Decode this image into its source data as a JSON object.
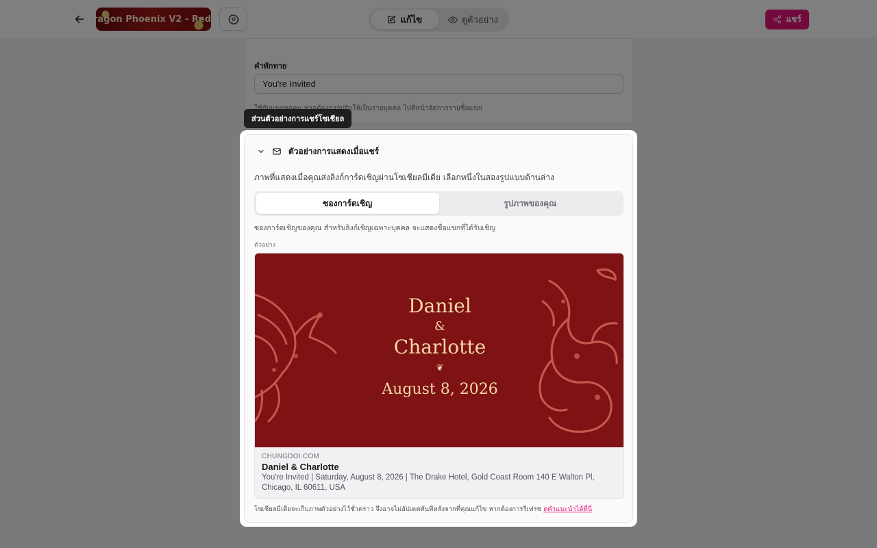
{
  "topbar": {
    "theme_name": "ragon Phoenix V2 - Red",
    "mode_edit": "แก้ไข",
    "mode_preview": "ดูตัวอย่าง",
    "share_label": "แชร์"
  },
  "greeting": {
    "label": "คำทักทาย",
    "value": "You're Invited",
    "hint": "ใช้กับแขกทุกคน หากต้องการปรับให้เป็นรายบุคคล ไปที่หน้าจัดการรายชื่อแขก"
  },
  "tooltip": "ส่วนตัวอย่างการแชร์โซเชียล",
  "share_preview": {
    "title": "ตัวอย่างการแสดงเมื่อแชร์",
    "description": "ภาพที่แสดงเมื่อคุณส่งลิงก์การ์ดเชิญผ่านโซเชียลมีเดีย เลือกหนึ่งในสองรูปแบบด้านล่าง",
    "tabs": [
      "ซองการ์ดเชิญ",
      "รูปภาพของคุณ"
    ],
    "selected_tab": "ซองการ์ดเชิญ",
    "tab_description": "ซองการ์ดเชิญของคุณ สำหรับลิงก์เชิญเฉพาะบุคคล จะแสดงชื่อแขกที่ได้รับเชิญ",
    "example_label": "ตัวอย่าง",
    "invite": {
      "name1": "Daniel",
      "amp": "&",
      "name2": "Charlotte",
      "ornament": "❦",
      "date": "August 8, 2026"
    },
    "meta": {
      "domain": "CHUNGDOI.COM",
      "title": "Daniel & Charlotte",
      "description": "You're Invited | Saturday, August 8, 2026 | The Drake Hotel, Gold Coast Room 140 E Walton Pl, Chicago, IL 60611, USA"
    },
    "footnote": "โซเชียลมีเดียจะเก็บภาพตัวอย่างไว้ชั่วคราว จึงอาจไม่อัปเดตทันทีหลังจากที่คุณแก้ไข หากต้องการรีเฟรช",
    "footnote_link": "ดูคำแนะนำได้ที่นี่"
  },
  "colors": {
    "accent": "#e5147a",
    "card_red": "#7e1214",
    "gold_text": "#f5d8a8",
    "overlay": "rgba(0,0,0,0.5)"
  }
}
